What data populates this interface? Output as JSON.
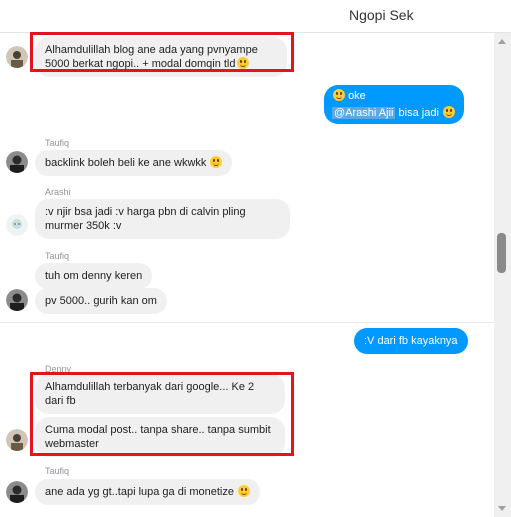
{
  "header": {
    "title": "Ngopi Sek"
  },
  "messages": [
    {
      "text": "Alhamdulillah blog ane ada yang pvnyampe 5000 berkat ngopi.. + modal domqin tld"
    },
    {
      "out1_line1": "oke",
      "out1_mention": "@Arashi Ajii",
      "out1_tail": " bisa jadi"
    },
    {
      "sender": "Taufiq",
      "text": "backlink boleh beli ke ane wkwkk"
    },
    {
      "sender": "Arashi",
      "text": ":v njir bsa jadi :v harga pbn di calvin pling murmer 350k :v"
    },
    {
      "sender": "Taufiq",
      "text": "tuh om denny keren"
    },
    {
      "text": "pv 5000.. gurih kan om"
    },
    {
      "text": ":V dari fb kayaknya"
    },
    {
      "sender": "Denny",
      "text": "Alhamdulillah terbanyak dari google... Ke 2 dari fb"
    },
    {
      "text": "Cuma modal post.. tanpa share.. tanpa sumbit webmaster"
    },
    {
      "sender": "Taufiq",
      "text": "ane ada yg gt..tapi lupa ga di monetize"
    }
  ]
}
